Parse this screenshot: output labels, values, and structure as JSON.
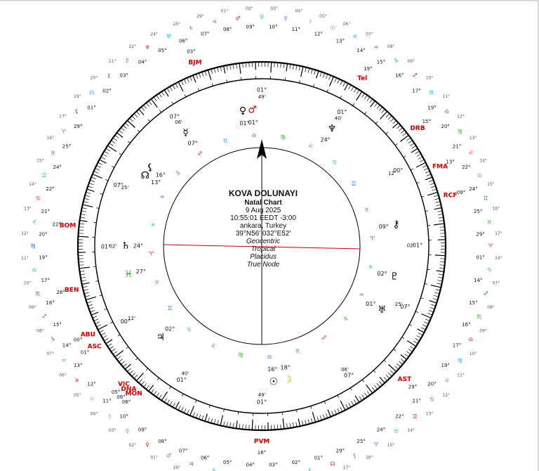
{
  "chart_info": {
    "title": "KOVA DOLUNAYI",
    "subtitle": "Natal Chart",
    "date": "9 Aug 2025",
    "time": "10:55:01 EEDT -3:00",
    "place": "ankara, Turkey",
    "coords": "39°N56' 032°E52'",
    "zodiac_type": "Geocentric",
    "zodiac": "Tropical",
    "house_system": "Placidus",
    "node": "True Node"
  },
  "colors": {
    "ring": "#000000",
    "horizon_line": "#cc0000",
    "point_label": "#d40000",
    "fire": "#e02020",
    "earth": "#3aa832",
    "air": "#2a6fe0",
    "water": "#1fb0d0",
    "planet_glyph": "#000000",
    "accent_purple": "#7b1fa2",
    "accent_yellow": "#c8a800",
    "accent_green": "#28a028"
  },
  "angle_markers": {
    "asc_lon": 183,
    "mc_lon": 273
  },
  "house_cusps": [
    {
      "house": 1,
      "lon": 183.2,
      "label": "01°",
      "minutes": "02'"
    },
    {
      "house": 2,
      "lon": 212,
      "label": "00°",
      "minutes": "12'"
    },
    {
      "house": 3,
      "lon": 242,
      "label": "01°",
      "minutes": "40'"
    },
    {
      "house": 4,
      "lon": 273,
      "label": "01°",
      "minutes": "49'"
    },
    {
      "house": 5,
      "lon": 307,
      "label": "07°",
      "minutes": "06'"
    },
    {
      "house": 6,
      "lon": 340,
      "label": "07°",
      "minutes": "25'"
    },
    {
      "house": 7,
      "lon": 3.2,
      "label": "01°",
      "minutes": "02'"
    },
    {
      "house": 8,
      "lon": 32,
      "label": "00°",
      "minutes": "12'"
    },
    {
      "house": 9,
      "lon": 62,
      "label": "01°",
      "minutes": "40'"
    },
    {
      "house": 10,
      "lon": 93,
      "label": "01°",
      "minutes": "49'"
    },
    {
      "house": 11,
      "lon": 127,
      "label": "07°",
      "minutes": "06'"
    },
    {
      "house": 12,
      "lon": 160,
      "label": "07°",
      "minutes": "25'"
    }
  ],
  "outer_points": [
    {
      "name": "BJM",
      "lon": 113,
      "deg": "03°"
    },
    {
      "name": "Tel",
      "lon": 62,
      "deg": "19°"
    },
    {
      "name": "DRB",
      "lon": 40,
      "deg": "15°"
    },
    {
      "name": "FMA",
      "lon": 27,
      "deg": "13°"
    },
    {
      "name": "RCF",
      "lon": 18,
      "deg": "09°"
    },
    {
      "name": "AST",
      "lon": 320,
      "deg": "29°"
    },
    {
      "name": "PVM",
      "lon": 273,
      "deg": "16°"
    },
    {
      "name": "MON",
      "lon": 232,
      "deg": "06°"
    },
    {
      "name": "DNA",
      "lon": 230,
      "deg": "06°"
    },
    {
      "name": "VIC",
      "lon": 228,
      "deg": "05°"
    },
    {
      "name": "ASC",
      "lon": 214,
      "deg": "01°"
    },
    {
      "name": "ABU",
      "lon": 210,
      "deg": "00°"
    },
    {
      "name": "BEN",
      "lon": 196,
      "deg": "28°"
    },
    {
      "name": "BOM",
      "lon": 177,
      "deg": "22°"
    }
  ],
  "outer_degree_labels": [
    "01°",
    "29°",
    "25°",
    "24°",
    "22°",
    "21°",
    "20°",
    "19°",
    "17°",
    "16°",
    "15°",
    "14°",
    "13°",
    "12°",
    "11°",
    "10°",
    "09°",
    "08°",
    "07°",
    "06°",
    "05°",
    "04°",
    "03°",
    "02°"
  ],
  "inner_planet_labels": [
    {
      "glyph": "☿",
      "deg": "07°",
      "lon": 127,
      "color": "#000000"
    },
    {
      "glyph": "♀",
      "deg": "01°",
      "lon": 101,
      "color": "#000000"
    },
    {
      "glyph": "♂",
      "deg": "01°",
      "lon": 97,
      "color": "#d40000"
    },
    {
      "glyph": "♆",
      "deg": "24°",
      "lon": 62,
      "color": "#000000"
    },
    {
      "glyph": "⚷",
      "deg": "09°",
      "lon": 12,
      "color": "#000000"
    },
    {
      "glyph": "♇",
      "deg": "02°",
      "lon": 350,
      "color": "#000000"
    },
    {
      "glyph": "♅",
      "deg": "01°",
      "lon": 335,
      "color": "#000000"
    },
    {
      "glyph": "☉",
      "deg": "16°",
      "lon": 278,
      "color": "#000000"
    },
    {
      "glyph": "☽",
      "deg": "18°",
      "lon": 284,
      "color": "#c8a800"
    },
    {
      "glyph": "♃",
      "deg": "02°",
      "lon": 225,
      "color": "#000000"
    },
    {
      "glyph": "♄",
      "deg": "24°",
      "lon": 183,
      "color": "#000000"
    },
    {
      "glyph": "☊",
      "deg": "13°",
      "lon": 152,
      "color": "#000000"
    },
    {
      "glyph": "⚸",
      "deg": "16°",
      "lon": 148,
      "color": "#000000"
    },
    {
      "glyph": "♓",
      "deg": "27°",
      "lon": 195,
      "color": "#3aa832"
    }
  ],
  "glyph_palette": [
    "☉",
    "☽",
    "☿",
    "♀",
    "♂",
    "♃",
    "♄",
    "♅",
    "♆",
    "♇",
    "⚷",
    "☊",
    "⚸",
    "♈",
    "♉",
    "♊",
    "♋",
    "♌",
    "♍",
    "♎",
    "♏",
    "♐",
    "♑",
    "♒",
    "♓"
  ]
}
